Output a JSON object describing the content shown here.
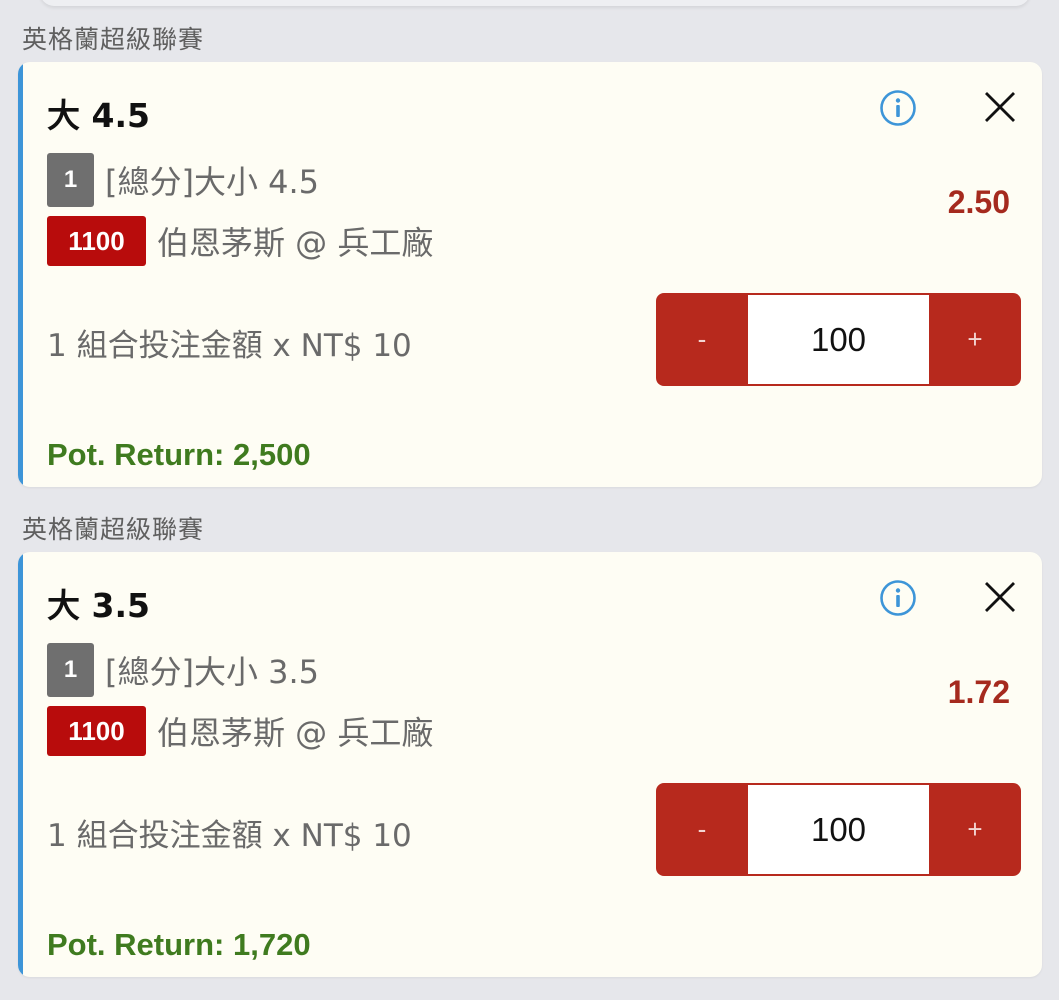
{
  "colors": {
    "page_bg": "#e6e7eb",
    "card_bg": "#fefdf4",
    "accent_blue": "#3d95d8",
    "odds_red": "#a52a1e",
    "stepper_red": "#b7291d",
    "badge_red": "#b80c0c",
    "badge_gray": "#6f6f6f",
    "return_green": "#3f7b1f"
  },
  "bets": [
    {
      "league": "英格蘭超級聯賽",
      "title": "大 4.5",
      "info_icon": "info-circle-icon",
      "close_icon": "close-icon",
      "market_badge": "1",
      "market": "[總分]大小 4.5",
      "match_badge": "1100",
      "match": "伯恩茅斯 @ 兵工廠",
      "odds": "2.50",
      "stake_label": "1 組合投注金額 x NT$ 10",
      "stepper": {
        "minus": "-",
        "value": "100",
        "plus": "+"
      },
      "return_label": "Pot. Return:",
      "return_value": "2,500"
    },
    {
      "league": "英格蘭超級聯賽",
      "title": "大 3.5",
      "info_icon": "info-circle-icon",
      "close_icon": "close-icon",
      "market_badge": "1",
      "market": "[總分]大小 3.5",
      "match_badge": "1100",
      "match": "伯恩茅斯 @ 兵工廠",
      "odds": "1.72",
      "stake_label": "1 組合投注金額 x NT$ 10",
      "stepper": {
        "minus": "-",
        "value": "100",
        "plus": "+"
      },
      "return_label": "Pot. Return:",
      "return_value": "1,720"
    }
  ]
}
